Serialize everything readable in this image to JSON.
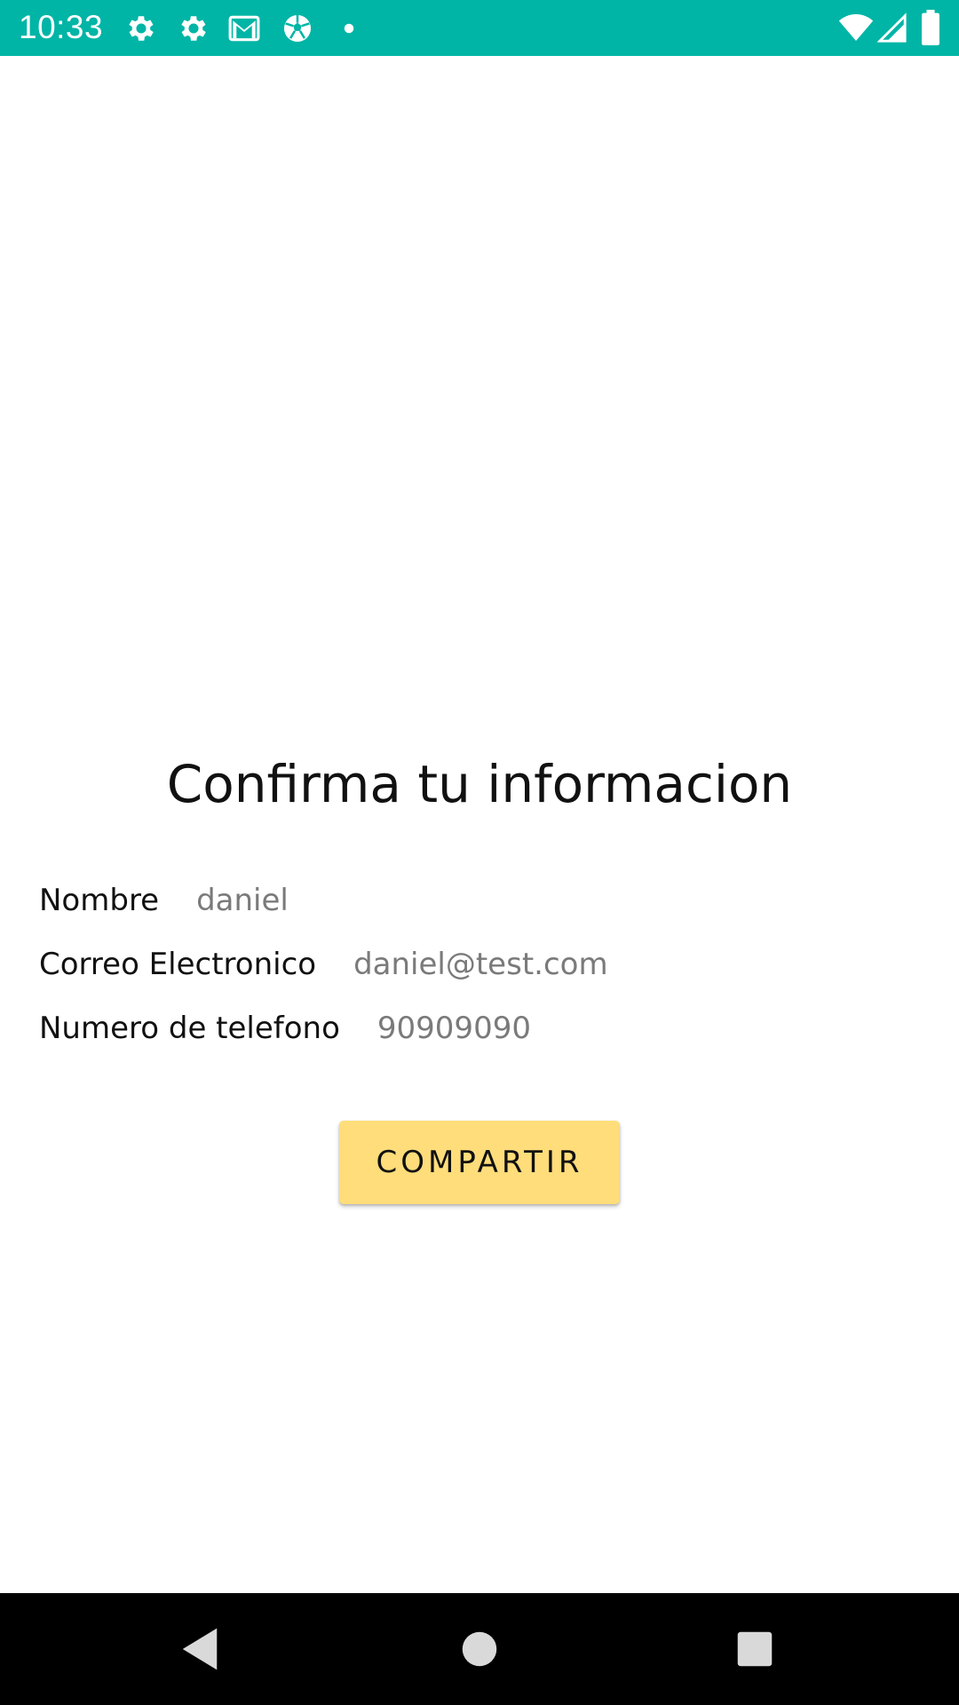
{
  "status_bar": {
    "time": "10:33",
    "background_color": "#00b5a6",
    "icons": [
      "settings-icon",
      "settings-icon",
      "gmail-icon",
      "soccer-ball-icon",
      "notification-dot-icon",
      "wifi-icon",
      "cell-signal-icon",
      "battery-icon"
    ]
  },
  "main": {
    "title": "Confirma tu informacion",
    "fields": [
      {
        "label": "Nombre",
        "value": "daniel"
      },
      {
        "label": "Correo Electronico",
        "value": "daniel@test.com"
      },
      {
        "label": "Numero de telefono",
        "value": "90909090"
      }
    ],
    "share_button": {
      "label": "COMPARTIR",
      "color": "#ffdd7a"
    }
  },
  "nav_bar": {
    "buttons": [
      "back-icon",
      "home-icon",
      "recents-icon"
    ]
  }
}
